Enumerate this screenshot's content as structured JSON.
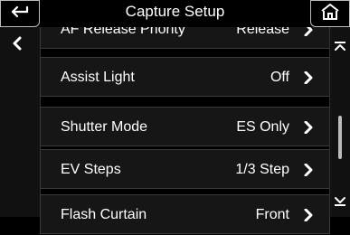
{
  "header": {
    "title": "Capture Setup"
  },
  "menu": [
    {
      "label": "AF Release Priority",
      "value": "Release"
    },
    {
      "label": "Assist Light",
      "value": "Off"
    },
    {
      "label": "Shutter Mode",
      "value": "ES Only"
    },
    {
      "label": "EV Steps",
      "value": "1/3 Step"
    },
    {
      "label": "Flash Curtain",
      "value": "Front"
    }
  ],
  "icons": {
    "back": "back-arrow-icon",
    "home": "home-icon",
    "left": "chevron-left-icon",
    "row": "chevron-right-icon",
    "scroll_up": "scroll-up-icon",
    "scroll_down": "scroll-down-icon"
  }
}
